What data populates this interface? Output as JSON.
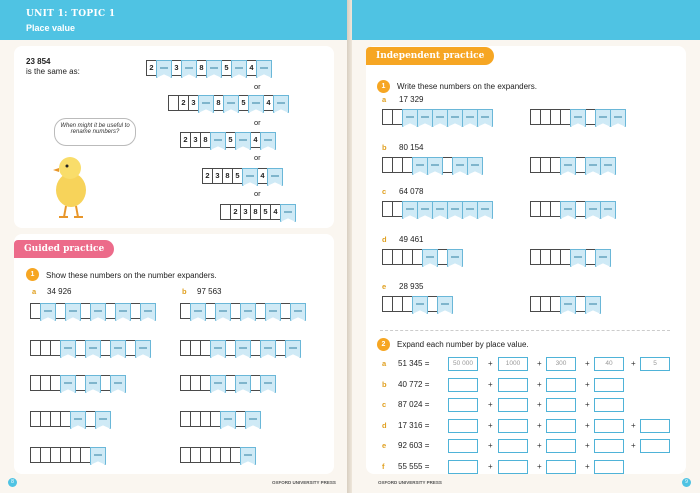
{
  "unit": {
    "title": "UNIT 1: TOPIC 1",
    "subtitle": "Place value"
  },
  "intro": {
    "number": "23 854",
    "text": "is the same as:",
    "or": "or",
    "bubble": "When might it be useful to rename numbers?"
  },
  "guided": {
    "header": "Guided practice",
    "q_num": "1",
    "q_text": "Show these numbers on the number expanders.",
    "a_label": "a",
    "a_value": "34 926",
    "b_label": "b",
    "b_value": "97 563"
  },
  "independent": {
    "header": "Independent practice",
    "q1_num": "1",
    "q1_text": "Write these numbers on the expanders.",
    "items": [
      {
        "label": "a",
        "value": "17 329"
      },
      {
        "label": "b",
        "value": "80 154"
      },
      {
        "label": "c",
        "value": "64 078"
      },
      {
        "label": "d",
        "value": "49 461"
      },
      {
        "label": "e",
        "value": "28 935"
      }
    ],
    "q2_num": "2",
    "q2_text": "Expand each number by place value.",
    "expand": [
      {
        "label": "a",
        "value": "51 345 =",
        "boxes": [
          "50 000",
          "1000",
          "300",
          "40",
          "5"
        ]
      },
      {
        "label": "b",
        "value": "40 772 ="
      },
      {
        "label": "c",
        "value": "87 024 ="
      },
      {
        "label": "d",
        "value": "17 316 ="
      },
      {
        "label": "e",
        "value": "92 603 ="
      },
      {
        "label": "f",
        "value": "55 555 ="
      }
    ]
  },
  "footer": {
    "left_page": "8",
    "right_page": "9",
    "left_press": "OXFORD UNIVERSITY PRESS",
    "right_press": "OXFORD UNIVERSITY PRESS"
  }
}
